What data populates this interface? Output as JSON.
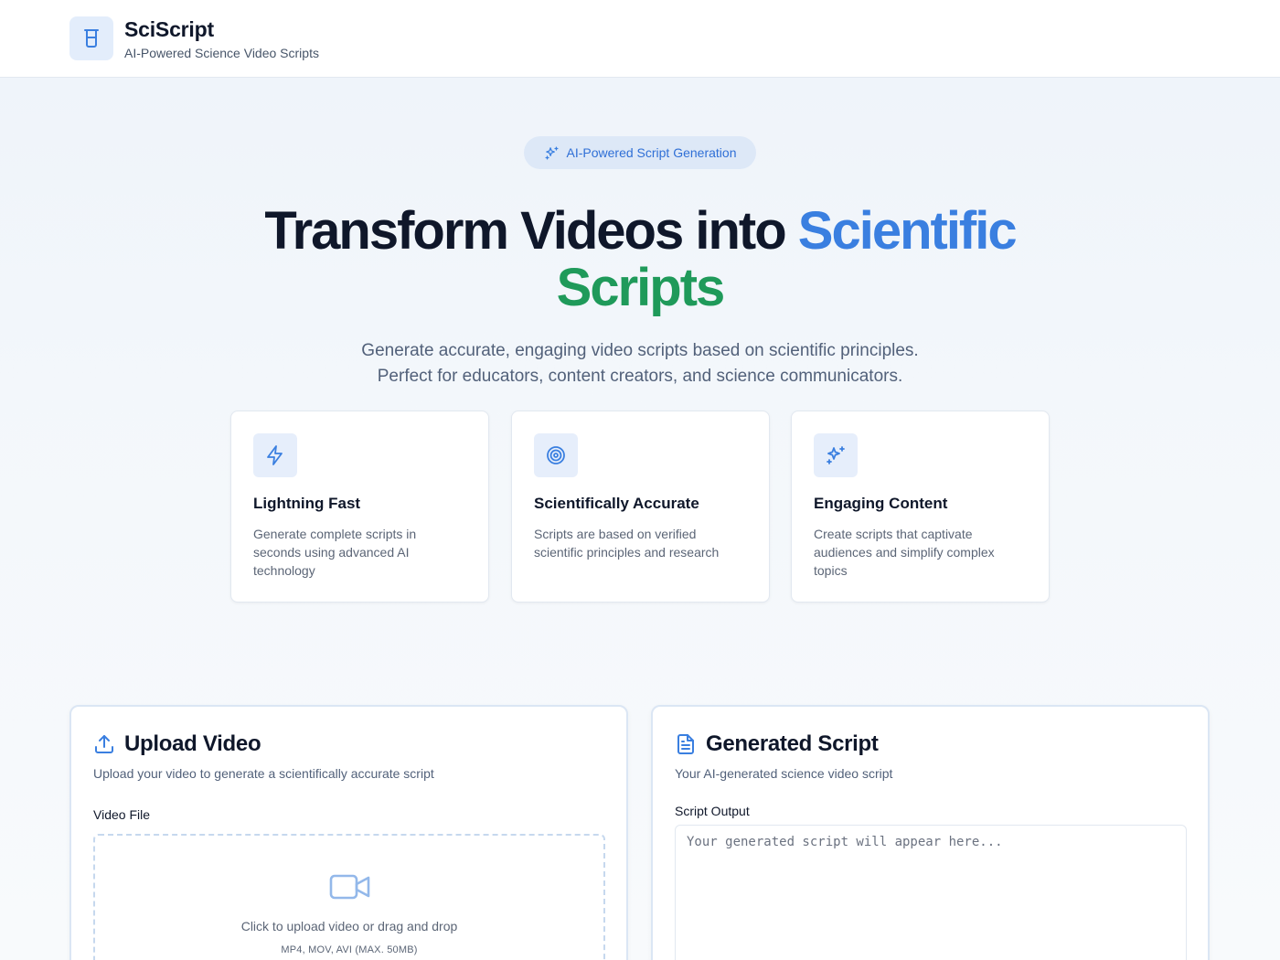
{
  "brand": {
    "title": "SciScript",
    "subtitle": "AI-Powered Science Video Scripts",
    "logo_icon": "beaker-icon"
  },
  "hero": {
    "badge": "AI-Powered Script Generation",
    "title_plain": "Transform Videos into ",
    "title_highlight_1": "Scientific",
    "title_highlight_2": "Scripts",
    "description_line1": "Generate accurate, engaging video scripts based on scientific principles.",
    "description_line2": "Perfect for educators, content creators, and science communicators."
  },
  "features": [
    {
      "icon": "lightning-icon",
      "title": "Lightning Fast",
      "description": "Generate complete scripts in seconds using advanced AI technology"
    },
    {
      "icon": "target-icon",
      "title": "Scientifically Accurate",
      "description": "Scripts are based on verified scientific principles and research"
    },
    {
      "icon": "sparkles-icon",
      "title": "Engaging Content",
      "description": "Create scripts that captivate audiences and simplify complex topics"
    }
  ],
  "upload": {
    "title": "Upload Video",
    "subtitle": "Upload your video to generate a scientifically accurate script",
    "field_label": "Video File",
    "dropzone_text": "Click to upload video or drag and drop",
    "dropzone_hint": "MP4, MOV, AVI (MAX. 50MB)"
  },
  "output": {
    "title": "Generated Script",
    "subtitle": "Your AI-generated science video script",
    "field_label": "Script Output",
    "placeholder": "Your generated script will appear here..."
  },
  "colors": {
    "accent_blue": "#3a7fe0",
    "accent_green": "#1f9a5a",
    "icon_tile": "#e6eefb"
  }
}
